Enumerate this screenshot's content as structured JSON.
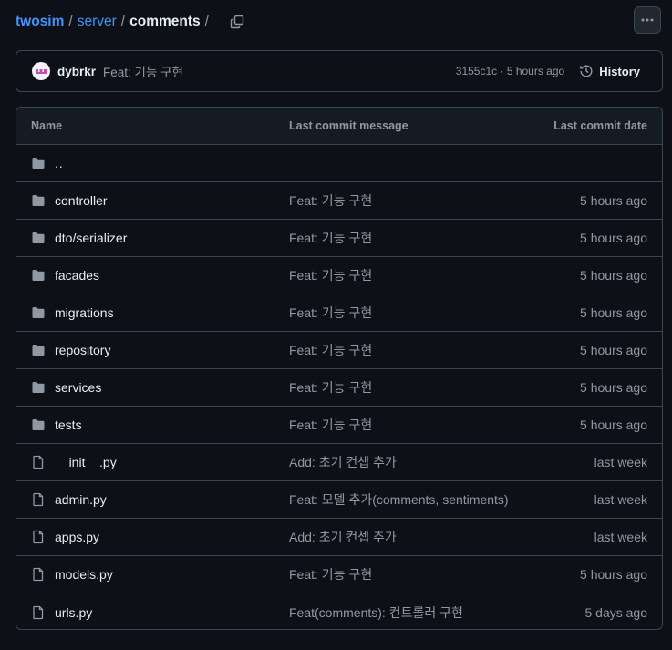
{
  "breadcrumb": {
    "repo": "twosim",
    "dir": "server",
    "current": "comments",
    "separator": "/"
  },
  "commit": {
    "author": "dybrkr",
    "message": "Feat: 기능 구현",
    "meta": "3155c1c · 5 hours ago",
    "history_label": "History"
  },
  "table": {
    "headers": {
      "name": "Name",
      "message": "Last commit message",
      "date": "Last commit date"
    },
    "parent": "..",
    "rows": [
      {
        "type": "folder",
        "name": "controller",
        "message": "Feat: 기능 구현",
        "date": "5 hours ago"
      },
      {
        "type": "folder",
        "name": "dto/serializer",
        "message": "Feat: 기능 구현",
        "date": "5 hours ago"
      },
      {
        "type": "folder",
        "name": "facades",
        "message": "Feat: 기능 구현",
        "date": "5 hours ago"
      },
      {
        "type": "folder",
        "name": "migrations",
        "message": "Feat: 기능 구현",
        "date": "5 hours ago"
      },
      {
        "type": "folder",
        "name": "repository",
        "message": "Feat: 기능 구현",
        "date": "5 hours ago"
      },
      {
        "type": "folder",
        "name": "services",
        "message": "Feat: 기능 구현",
        "date": "5 hours ago"
      },
      {
        "type": "folder",
        "name": "tests",
        "message": "Feat: 기능 구현",
        "date": "5 hours ago"
      },
      {
        "type": "file",
        "name": "__init__.py",
        "message": "Add: 초기 컨셉 추가",
        "date": "last week"
      },
      {
        "type": "file",
        "name": "admin.py",
        "message": "Feat: 모델 추가(comments, sentiments)",
        "date": "last week"
      },
      {
        "type": "file",
        "name": "apps.py",
        "message": "Add: 초기 컨셉 추가",
        "date": "last week"
      },
      {
        "type": "file",
        "name": "models.py",
        "message": "Feat: 기능 구현",
        "date": "5 hours ago"
      },
      {
        "type": "file",
        "name": "urls.py",
        "message": "Feat(comments): 컨트롤러 구현",
        "date": "5 days ago"
      }
    ]
  }
}
